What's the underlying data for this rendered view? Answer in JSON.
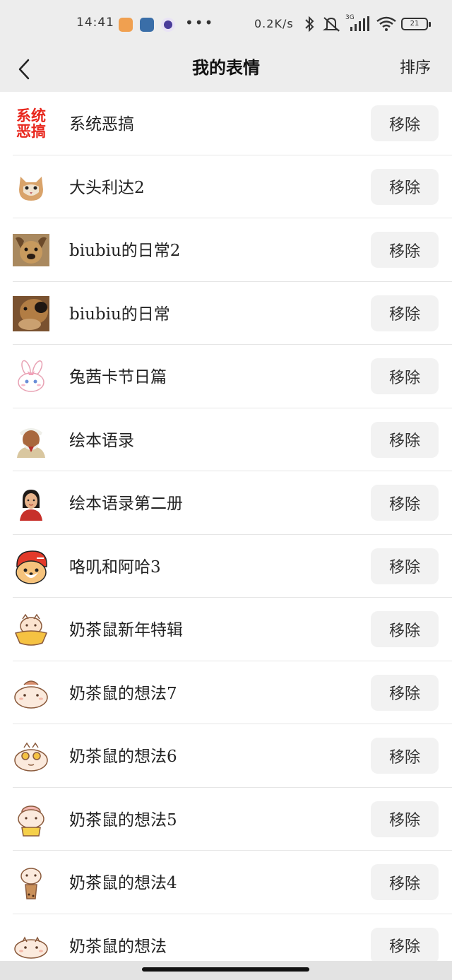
{
  "status": {
    "time": "14:41",
    "dots": "•••",
    "speed": "0.2K/s",
    "network": "3G",
    "battery": "21",
    "icons": [
      "notes-app-icon",
      "settings-app-icon",
      "browser-app-icon",
      "bluetooth-icon",
      "mute-icon",
      "signal-icon",
      "wifi-icon",
      "battery-icon"
    ]
  },
  "nav": {
    "title": "我的表情",
    "sort_label": "排序",
    "back_icon": "chevron-left-icon"
  },
  "system_sticker_badge": {
    "line1": "系统",
    "line2": "恶搞",
    "color": "#e8261c"
  },
  "colors": {
    "background": "#ededed",
    "button_bg": "#f2f2f2",
    "text": "#222222"
  },
  "items": [
    {
      "title": "系统恶搞",
      "button": "移除",
      "icon": "system-prank-badge-icon"
    },
    {
      "title": "大头利达2",
      "button": "移除",
      "icon": "cat-face-icon"
    },
    {
      "title": "biubiu的日常2",
      "button": "移除",
      "icon": "dog-face-icon"
    },
    {
      "title": "biubiu的日常",
      "button": "移除",
      "icon": "dog-closeup-icon"
    },
    {
      "title": "兔茜卡节日篇",
      "button": "移除",
      "icon": "pink-rabbit-icon"
    },
    {
      "title": "绘本语录",
      "button": "移除",
      "icon": "old-man-portrait-icon"
    },
    {
      "title": "绘本语录第二册",
      "button": "移除",
      "icon": "girl-portrait-icon"
    },
    {
      "title": "咯叽和阿哈3",
      "button": "移除",
      "icon": "corgi-helmet-icon"
    },
    {
      "title": "奶茶鼠新年特辑",
      "button": "移除",
      "icon": "hamster-newyear-icon"
    },
    {
      "title": "奶茶鼠的想法7",
      "button": "移除",
      "icon": "hamster-icon"
    },
    {
      "title": "奶茶鼠的想法6",
      "button": "移除",
      "icon": "hamster-glasses-icon"
    },
    {
      "title": "奶茶鼠的想法5",
      "button": "移除",
      "icon": "hamster-yellow-icon"
    },
    {
      "title": "奶茶鼠的想法4",
      "button": "移除",
      "icon": "hamster-milktea-icon"
    },
    {
      "title": "奶茶鼠的想法",
      "button": "移除",
      "icon": "hamster-lying-icon"
    }
  ]
}
